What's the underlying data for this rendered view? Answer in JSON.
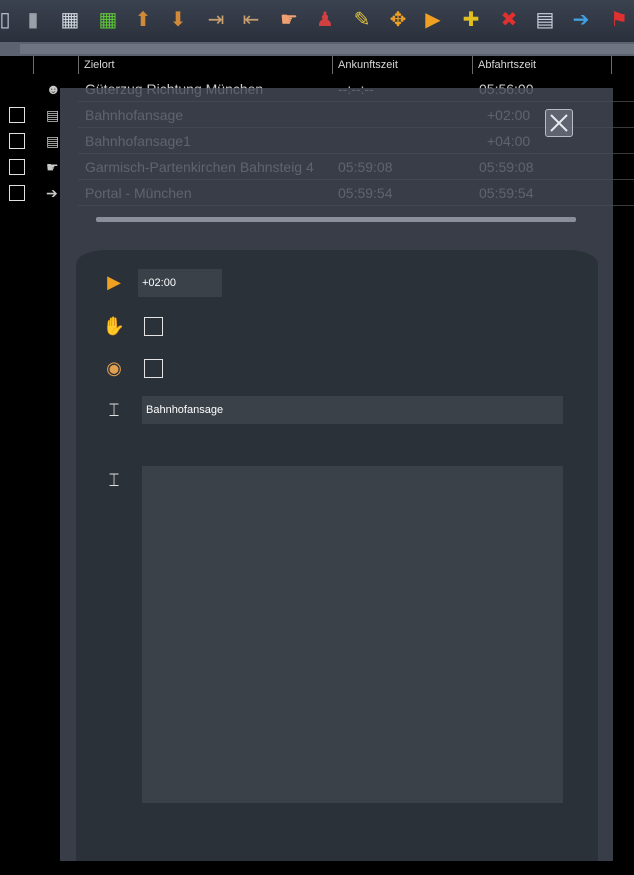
{
  "toolbar": {
    "buttons": [
      {
        "name": "page-icon",
        "glyph": "▯",
        "color": "#c0c8d8"
      },
      {
        "name": "trash-icon",
        "glyph": "▮",
        "color": "#9aa0a8"
      },
      {
        "name": "grid-small-icon",
        "glyph": "▦",
        "color": "#d0d4dc"
      },
      {
        "name": "grid-green-icon",
        "glyph": "▦",
        "color": "#5ec23a"
      },
      {
        "name": "move-up-icon",
        "glyph": "⬆",
        "color": "#d08a3a"
      },
      {
        "name": "move-down-icon",
        "glyph": "⬇",
        "color": "#d08a3a"
      },
      {
        "name": "insert-before-icon",
        "glyph": "⇥",
        "color": "#c8a070"
      },
      {
        "name": "insert-after-icon",
        "glyph": "⇤",
        "color": "#c8a070"
      },
      {
        "name": "pointing-hand-icon",
        "glyph": "☛",
        "color": "#f0a070"
      },
      {
        "name": "persons-icon",
        "glyph": "♟",
        "color": "#d04040"
      },
      {
        "name": "edit-signal-icon",
        "glyph": "✎",
        "color": "#e0c040"
      },
      {
        "name": "expand-arrows-icon",
        "glyph": "✥",
        "color": "#f0a020"
      },
      {
        "name": "play-add-icon",
        "glyph": "▶",
        "color": "#f0a020"
      },
      {
        "name": "add-green-icon",
        "glyph": "✚",
        "color": "#e0c020"
      },
      {
        "name": "delete-icon",
        "glyph": "✖",
        "color": "#e03030"
      },
      {
        "name": "announcement-settings-icon",
        "glyph": "▤",
        "color": "#c8d0dc"
      },
      {
        "name": "portal-enter-icon",
        "glyph": "➔",
        "color": "#40a0e0"
      },
      {
        "name": "flag-icon",
        "glyph": "⚑",
        "color": "#e03030"
      }
    ]
  },
  "columns": {
    "destination": "Zielort",
    "arrival": "Ankunftszeit",
    "departure": "Abfahrtszeit"
  },
  "rows": [
    {
      "icon": "driver-icon",
      "glyph": "☻",
      "destination": "Güterzug Richtung München",
      "arrival": "--:--:--",
      "departure": "05:56:00",
      "checkbox": false
    },
    {
      "icon": "announcement-icon",
      "glyph": "▤",
      "destination": "Bahnhofansage",
      "arrival": "",
      "departure": "+02:00",
      "checkbox": true
    },
    {
      "icon": "announcement-icon",
      "glyph": "▤",
      "destination": "Bahnhofansage1",
      "arrival": "",
      "departure": "+04:00",
      "checkbox": true
    },
    {
      "icon": "pointing-hand-icon",
      "glyph": "☛",
      "destination": "Garmisch-Partenkirchen Bahnsteig 4",
      "arrival": "05:59:08",
      "departure": "05:59:08",
      "checkbox": true
    },
    {
      "icon": "portal-icon",
      "glyph": "➔",
      "destination": "Portal - München",
      "arrival": "05:59:54",
      "departure": "05:59:54",
      "checkbox": true
    }
  ],
  "editor": {
    "time_offset": "+02:00",
    "announcement_name": "Bahnhofansage",
    "description": "",
    "stop_checkbox": false,
    "audio_checkbox": false
  }
}
